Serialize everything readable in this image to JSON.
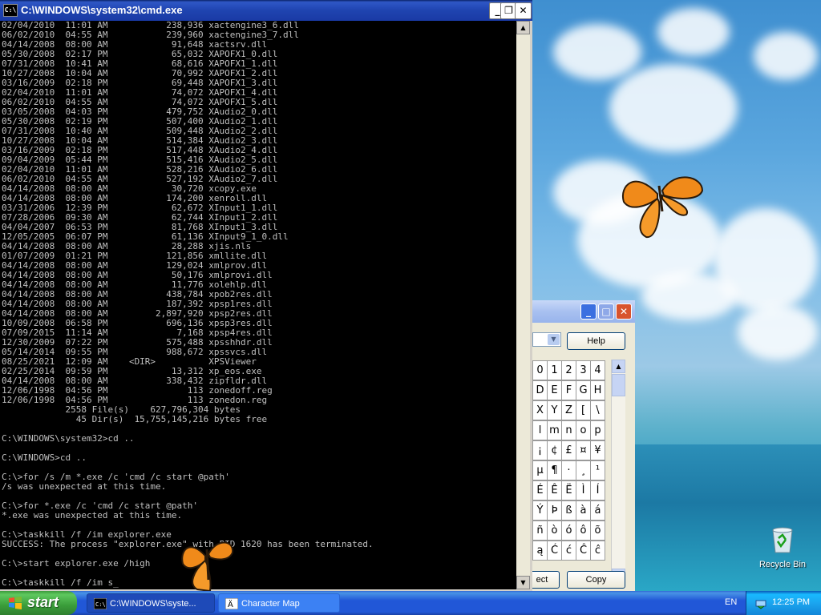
{
  "cmd": {
    "title": "C:\\WINDOWS\\system32\\cmd.exe",
    "icon_label": "C:\\",
    "lines": [
      "02/04/2010  11:01 AM           238,936 xactengine3_6.dll",
      "06/02/2010  04:55 AM           239,960 xactengine3_7.dll",
      "04/14/2008  08:00 AM            91,648 xactsrv.dll",
      "05/30/2008  02:17 PM            65,032 XAPOFX1_0.dll",
      "07/31/2008  10:41 AM            68,616 XAPOFX1_1.dll",
      "10/27/2008  10:04 AM            70,992 XAPOFX1_2.dll",
      "03/16/2009  02:18 PM            69,448 XAPOFX1_3.dll",
      "02/04/2010  11:01 AM            74,072 XAPOFX1_4.dll",
      "06/02/2010  04:55 AM            74,072 XAPOFX1_5.dll",
      "03/05/2008  04:03 PM           479,752 XAudio2_0.dll",
      "05/30/2008  02:19 PM           507,400 XAudio2_1.dll",
      "07/31/2008  10:40 AM           509,448 XAudio2_2.dll",
      "10/27/2008  10:04 AM           514,384 XAudio2_3.dll",
      "03/16/2009  02:18 PM           517,448 XAudio2_4.dll",
      "09/04/2009  05:44 PM           515,416 XAudio2_5.dll",
      "02/04/2010  11:01 AM           528,216 XAudio2_6.dll",
      "06/02/2010  04:55 AM           527,192 XAudio2_7.dll",
      "04/14/2008  08:00 AM            30,720 xcopy.exe",
      "04/14/2008  08:00 AM           174,200 xenroll.dll",
      "03/31/2006  12:39 PM            62,672 XInput1_1.dll",
      "07/28/2006  09:30 AM            62,744 XInput1_2.dll",
      "04/04/2007  06:53 PM            81,768 XInput1_3.dll",
      "12/05/2005  06:07 PM            61,136 XInput9_1_0.dll",
      "04/14/2008  08:00 AM            28,288 xjis.nls",
      "01/07/2009  01:21 PM           121,856 xmllite.dll",
      "04/14/2008  08:00 AM           129,024 xmlprov.dll",
      "04/14/2008  08:00 AM            50,176 xmlprovi.dll",
      "04/14/2008  08:00 AM            11,776 xolehlp.dll",
      "04/14/2008  08:00 AM           438,784 xpob2res.dll",
      "04/14/2008  08:00 AM           187,392 xpsp1res.dll",
      "04/14/2008  08:00 AM         2,897,920 xpsp2res.dll",
      "10/09/2008  06:58 PM           696,136 xpsp3res.dll",
      "07/09/2015  11:14 AM             7,168 xpsp4res.dll",
      "12/30/2009  07:22 PM           575,488 xpsshhdr.dll",
      "05/14/2014  09:55 PM           988,672 xpssvcs.dll",
      "08/25/2021  12:09 AM    <DIR>          XPSViewer",
      "02/25/2014  09:59 PM            13,312 xp_eos.exe",
      "04/14/2008  08:00 AM           338,432 zipfldr.dll",
      "12/06/1998  04:56 PM               113 zonedoff.reg",
      "12/06/1998  04:56 PM               113 zonedon.reg",
      "            2558 File(s)    627,796,304 bytes",
      "              45 Dir(s)  15,755,145,216 bytes free",
      "",
      "C:\\WINDOWS\\system32>cd ..",
      "",
      "C:\\WINDOWS>cd ..",
      "",
      "C:\\>for /s /m *.exe /c 'cmd /c start @path'",
      "/s was unexpected at this time.",
      "",
      "C:\\>for *.exe /c 'cmd /c start @path'",
      "*.exe was unexpected at this time.",
      "",
      "C:\\>taskkill /f /im explorer.exe",
      "SUCCESS: The process \"explorer.exe\" with PID 1620 has been terminated.",
      "",
      "C:\\>start explorer.exe /high",
      "",
      "C:\\>taskkill /f /im s_"
    ]
  },
  "charmap": {
    "help_label": "Help",
    "select_label": "ect",
    "copy_label": "Copy",
    "grid": [
      [
        "0",
        "1",
        "2",
        "3",
        "4"
      ],
      [
        "D",
        "E",
        "F",
        "G",
        "H"
      ],
      [
        "X",
        "Y",
        "Z",
        "[",
        "\\"
      ],
      [
        "l",
        "m",
        "n",
        "o",
        "p"
      ],
      [
        "¡",
        "¢",
        "£",
        "¤",
        "¥"
      ],
      [
        "µ",
        "¶",
        "·",
        "¸",
        "¹"
      ],
      [
        "É",
        "Ê",
        "Ë",
        "Ì",
        "Í"
      ],
      [
        "Ý",
        "Þ",
        "ß",
        "à",
        "á"
      ],
      [
        "ñ",
        "ò",
        "ó",
        "ô",
        "õ"
      ],
      [
        "ą",
        "Ć",
        "ć",
        "Ĉ",
        "ĉ"
      ]
    ]
  },
  "desktop": {
    "recycle_bin_label": "Recycle Bin"
  },
  "taskbar": {
    "start_label": "start",
    "tasks": [
      {
        "label": "C:\\WINDOWS\\syste...",
        "icon": "cmd-icon"
      },
      {
        "label": "Character Map",
        "icon": "charmap-icon"
      }
    ],
    "language": "EN",
    "clock": "12:25 PM"
  },
  "colors": {
    "console_bg": "#000000",
    "console_fg": "#c0c0c0",
    "taskbar_blue": "#2157d7",
    "start_green": "#3a9d3a"
  }
}
